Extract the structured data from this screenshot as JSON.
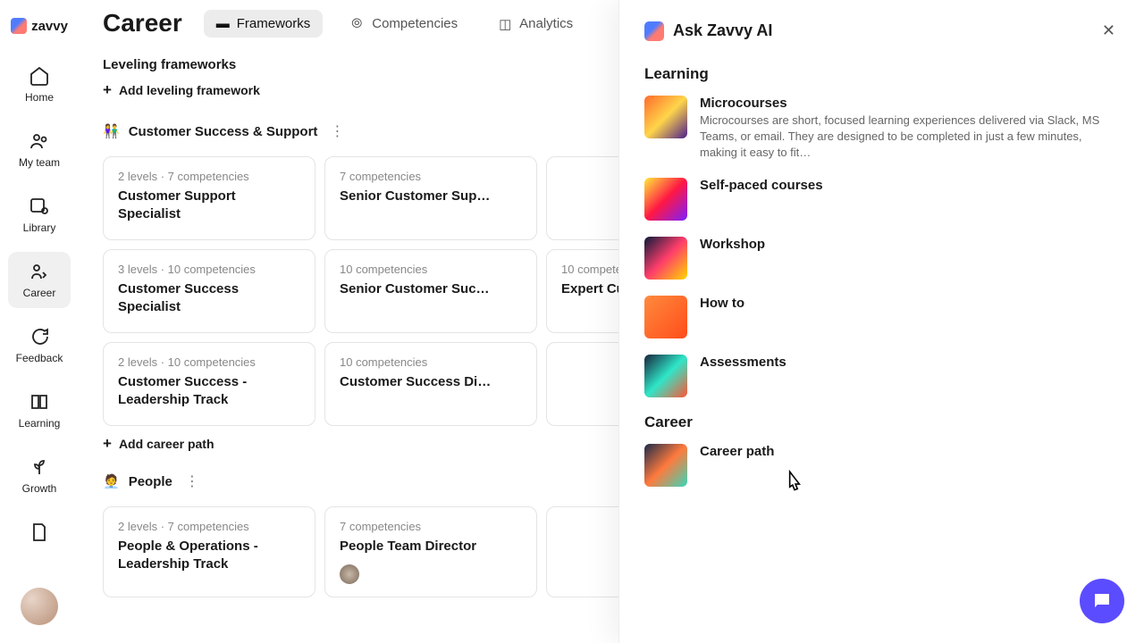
{
  "brand": "zavvy",
  "sidebar": {
    "items": [
      {
        "label": "Home"
      },
      {
        "label": "My team"
      },
      {
        "label": "Library"
      },
      {
        "label": "Career"
      },
      {
        "label": "Feedback"
      },
      {
        "label": "Learning"
      },
      {
        "label": "Growth"
      }
    ]
  },
  "page": {
    "title": "Career",
    "tabs": [
      {
        "label": "Frameworks"
      },
      {
        "label": "Competencies"
      },
      {
        "label": "Analytics"
      }
    ]
  },
  "frameworks": {
    "section_title": "Leveling frameworks",
    "add_label": "Add leveling framework",
    "add_path_label": "Add career path",
    "tracks": [
      {
        "emoji": "👫",
        "name": "Customer Success & Support",
        "rows": [
          [
            {
              "meta": "2 levels · 7 competencies",
              "title": "Customer Support Specialist"
            },
            {
              "meta": "7 competencies",
              "title": "Senior Customer Sup…"
            },
            {
              "meta": "",
              "title": ""
            }
          ],
          [
            {
              "meta": "3 levels · 10 competencies",
              "title": "Customer Success Specialist"
            },
            {
              "meta": "10 competencies",
              "title": "Senior Customer Suc…"
            },
            {
              "meta": "10 compete",
              "title": "Expert Cus"
            }
          ],
          [
            {
              "meta": "2 levels · 10 competencies",
              "title": "Customer Success - Leadership Track"
            },
            {
              "meta": "10 competencies",
              "title": "Customer Success Di…"
            },
            {
              "meta": "",
              "title": ""
            }
          ]
        ]
      },
      {
        "emoji": "🧑‍💼",
        "name": "People",
        "rows": [
          [
            {
              "meta": "2 levels · 7 competencies",
              "title": "People & Operations - Leadership Track"
            },
            {
              "meta": "7 competencies",
              "title": "People Team Director",
              "avatar": true
            },
            {
              "meta": "",
              "title": ""
            }
          ]
        ]
      }
    ]
  },
  "panel": {
    "title": "Ask Zavvy AI",
    "sections": [
      {
        "title": "Learning",
        "options": [
          {
            "title": "Microcourses",
            "desc": "Microcourses are short, focused learning experiences delivered via Slack, MS Teams, or email. They are designed to be completed in just a few minutes, making it easy to fit…"
          },
          {
            "title": "Self-paced courses",
            "desc": ""
          },
          {
            "title": "Workshop",
            "desc": ""
          },
          {
            "title": "How to",
            "desc": ""
          },
          {
            "title": "Assessments",
            "desc": ""
          }
        ]
      },
      {
        "title": "Career",
        "options": [
          {
            "title": "Career path",
            "desc": ""
          }
        ]
      }
    ]
  }
}
